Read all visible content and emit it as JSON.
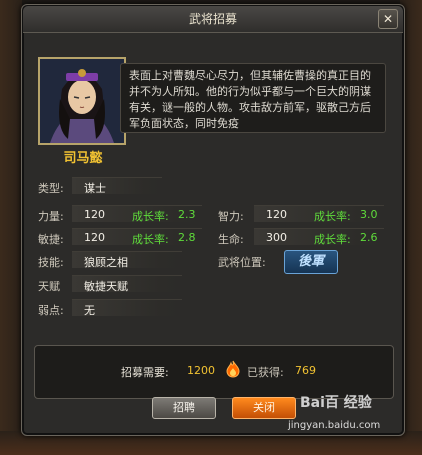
{
  "window": {
    "title": "武将招募",
    "close_glyph": "✕"
  },
  "hero": {
    "name": "司马懿",
    "description": "表面上对曹魏尽心尽力，但其辅佐曹操的真正目的并不为人所知。他的行为似乎都与一个巨大的阴谋有关，谜一般的人物。攻击敌方前军，驱散己方后军负面状态，同时免疫"
  },
  "stats": {
    "type_label": "类型:",
    "type_value": "谋士",
    "power_label": "力量:",
    "power_value": "120",
    "power_growth_label": "成长率:",
    "power_growth": "2.3",
    "int_label": "智力:",
    "int_value": "120",
    "int_growth_label": "成长率:",
    "int_growth": "3.0",
    "agi_label": "敏捷:",
    "agi_value": "120",
    "agi_growth_label": "成长率:",
    "agi_growth": "2.8",
    "life_label": "生命:",
    "life_value": "300",
    "life_growth_label": "成长率:",
    "life_growth": "2.6",
    "skill_label": "技能:",
    "skill_value": "狼顾之相",
    "position_label": "武将位置:",
    "position_value": "後軍",
    "talent_label": "天赋",
    "talent_value": "敏捷天赋",
    "weakness_label": "弱点:",
    "weakness_value": "无"
  },
  "recruit": {
    "need_label": "招募需要:",
    "need_value": "1200",
    "owned_label": "已获得:",
    "owned_value": "769"
  },
  "buttons": {
    "recruit": "招聘",
    "close": "关闭"
  },
  "watermark": {
    "logo": "Bai百 经验",
    "url": "jingyan.baidu.com"
  },
  "colors": {
    "accent_gold": "#f1c232",
    "growth_green": "#5fdc3b",
    "close_orange": "#ff8a1e"
  }
}
